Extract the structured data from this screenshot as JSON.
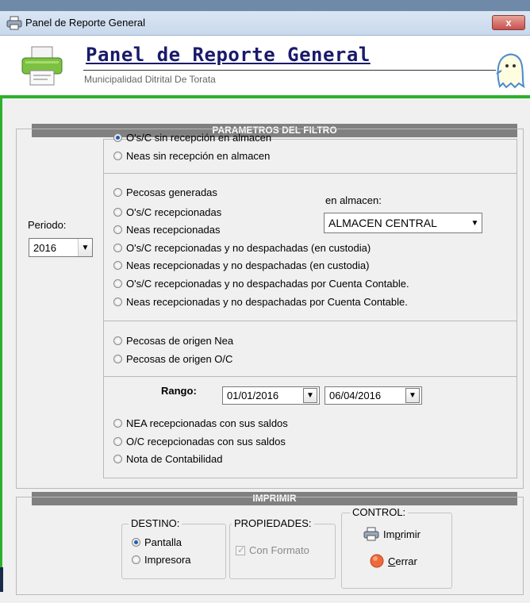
{
  "window": {
    "title": "Panel de Reporte General",
    "close_label": "x"
  },
  "header": {
    "title": "Panel de Reporte General",
    "subtitle": "Municipalidad Ditrital De Torata"
  },
  "filter": {
    "section_title": "PARAMETROS DEL FILTRO",
    "periodo_label": "Periodo:",
    "periodo_value": "2016",
    "group1": [
      {
        "label": "O's/C sin recepción en almacen",
        "checked": true
      },
      {
        "label": "Neas sin recepción en almacen",
        "checked": false
      }
    ],
    "group2": [
      {
        "label": "Pecosas generadas",
        "checked": false
      },
      {
        "label": "O's/C recepcionadas",
        "checked": false
      },
      {
        "label": "Neas recepcionadas",
        "checked": false
      },
      {
        "label": "O's/C recepcionadas y no despachadas (en custodia)",
        "checked": false
      },
      {
        "label": "Neas recepcionadas y no despachadas (en custodia)",
        "checked": false
      },
      {
        "label": "O's/C recepcionadas y no despachadas por Cuenta Contable.",
        "checked": false
      },
      {
        "label": "Neas recepcionadas y no despachadas por Cuenta Contable.",
        "checked": false
      }
    ],
    "almacen_label": "en almacen:",
    "almacen_value": "ALMACEN CENTRAL",
    "group3": [
      {
        "label": "Pecosas de origen Nea",
        "checked": false
      },
      {
        "label": "Pecosas de origen O/C",
        "checked": false
      }
    ],
    "rango_label": "Rango:",
    "rango_from": "01/01/2016",
    "rango_to": "06/04/2016",
    "group4": [
      {
        "label": "NEA recepcionadas con sus saldos",
        "checked": false
      },
      {
        "label": "O/C recepcionadas con sus saldos",
        "checked": false
      },
      {
        "label": "Nota de Contabilidad",
        "checked": false
      }
    ]
  },
  "print": {
    "section_title": "IMPRIMIR",
    "destino_label": "DESTINO:",
    "destino_options": [
      {
        "label": "Pantalla",
        "checked": true
      },
      {
        "label": "Impresora",
        "checked": false
      }
    ],
    "propiedades_label": "PROPIEDADES:",
    "con_formato_label": "Con Formato",
    "control_label": "CONTROL:",
    "imprimir": {
      "pre": "Im",
      "u": "p",
      "post": "rimir"
    },
    "cerrar": {
      "pre": "",
      "u": "C",
      "post": "errar"
    }
  },
  "icons": [
    "printer-icon",
    "ghost-icon",
    "chevron-down-icon",
    "stop-icon"
  ]
}
